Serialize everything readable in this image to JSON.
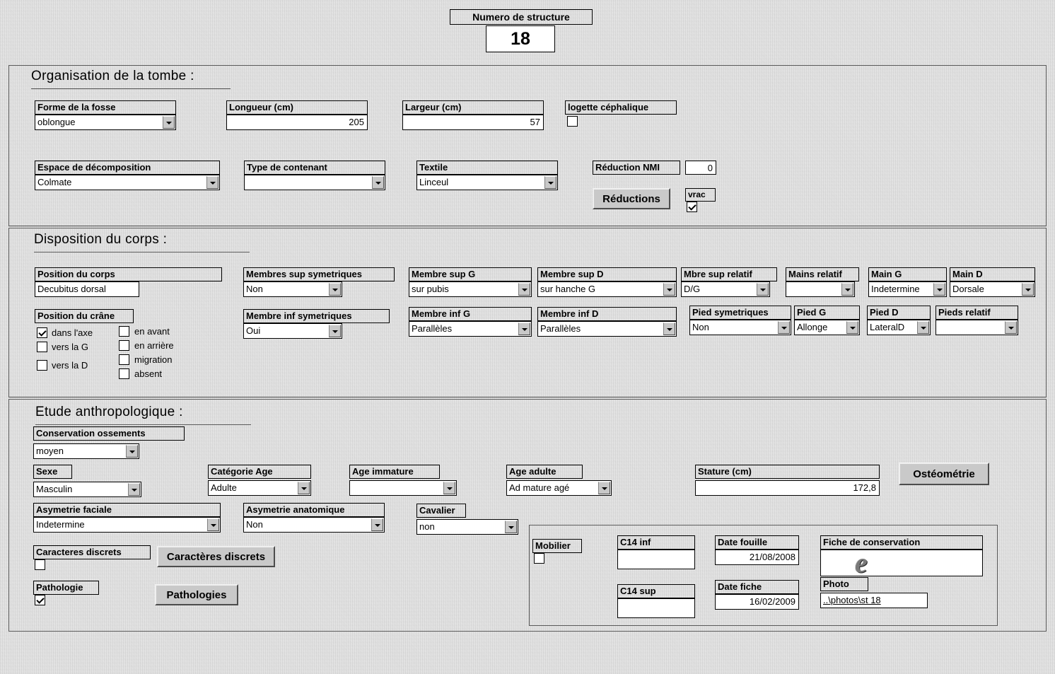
{
  "header": {
    "structure_label": "Numero de structure",
    "structure_value": "18"
  },
  "sections": {
    "tombe": {
      "title": "Organisation de la tombe :",
      "fields": {
        "forme_fosse": {
          "label": "Forme de la fosse",
          "value": "oblongue"
        },
        "longueur": {
          "label": "Longueur (cm)",
          "value": "205"
        },
        "largeur": {
          "label": "Largeur (cm)",
          "value": "57"
        },
        "logette": {
          "label": "logette céphalique",
          "checked": false
        },
        "espace_decomposition": {
          "label": "Espace de décomposition",
          "value": "Colmate"
        },
        "type_contenant": {
          "label": "Type de contenant",
          "value": ""
        },
        "textile": {
          "label": "Textile",
          "value": "Linceul"
        },
        "reduction_nmi": {
          "label": "Réduction NMI",
          "value": "0"
        },
        "reductions_button": "Réductions",
        "vrac": {
          "label": "vrac",
          "checked": true
        }
      }
    },
    "corps": {
      "title": "Disposition du corps :",
      "fields": {
        "position_corps": {
          "label": "Position du corps",
          "value": "Decubitus dorsal"
        },
        "membres_sup_sym": {
          "label": "Membres sup symetriques",
          "value": "Non"
        },
        "membre_sup_g": {
          "label": "Membre sup G",
          "value": "sur pubis"
        },
        "membre_sup_d": {
          "label": "Membre sup D",
          "value": "sur hanche G"
        },
        "mbre_sup_relatif": {
          "label": "Mbre sup relatif",
          "value": "D/G"
        },
        "mains_relatif": {
          "label": "Mains relatif",
          "value": ""
        },
        "main_g": {
          "label": "Main G",
          "value": "Indetermine"
        },
        "main_d": {
          "label": "Main D",
          "value": "Dorsale"
        },
        "position_crane": {
          "label": "Position du crâne"
        },
        "membre_inf_sym": {
          "label": "Membre inf symetriques",
          "value": "Oui"
        },
        "membre_inf_g": {
          "label": "Membre inf G",
          "value": "Parallèles"
        },
        "membre_inf_d": {
          "label": "Membre inf D",
          "value": "Parallèles"
        },
        "pied_sym": {
          "label": "Pied symetriques",
          "value": "Non"
        },
        "pied_g": {
          "label": "Pied G",
          "value": "Allonge"
        },
        "pied_d": {
          "label": "Pied D",
          "value": "LateralD"
        },
        "pieds_relatif": {
          "label": "Pieds relatif",
          "value": ""
        }
      },
      "crane_options_col1": [
        {
          "label": "dans l'axe",
          "checked": true
        },
        {
          "label": "vers la G",
          "checked": false
        },
        {
          "label": "vers la D",
          "checked": false
        }
      ],
      "crane_options_col2": [
        {
          "label": "en avant",
          "checked": false
        },
        {
          "label": "en arrière",
          "checked": false
        },
        {
          "label": "migration",
          "checked": false
        },
        {
          "label": "absent",
          "checked": false
        }
      ]
    },
    "anthropologie": {
      "title": "Etude anthropologique :",
      "fields": {
        "conservation_ossements": {
          "label": "Conservation ossements",
          "value": "moyen"
        },
        "sexe": {
          "label": "Sexe",
          "value": "Masculin"
        },
        "categorie_age": {
          "label": "Catégorie Age",
          "value": "Adulte"
        },
        "age_immature": {
          "label": "Age immature",
          "value": ""
        },
        "age_adulte": {
          "label": "Age adulte",
          "value": "Ad mature agé"
        },
        "stature": {
          "label": "Stature (cm)",
          "value": "172,8"
        },
        "osteometrie_button": "Ostéométrie",
        "asymetrie_faciale": {
          "label": "Asymetrie faciale",
          "value": "Indetermine"
        },
        "asymetrie_anatomique": {
          "label": "Asymetrie anatomique",
          "value": "Non"
        },
        "cavalier": {
          "label": "Cavalier",
          "value": "non"
        },
        "caracteres_discrets": {
          "label": "Caracteres discrets",
          "checked": false
        },
        "caracteres_discrets_button": "Caractères discrets",
        "pathologie": {
          "label": "Pathologie",
          "checked": true
        },
        "pathologies_button": "Pathologies",
        "mobilier": {
          "label": "Mobilier",
          "checked": false
        },
        "c14_inf": {
          "label": "C14 inf",
          "value": ""
        },
        "c14_sup": {
          "label": "C14 sup",
          "value": ""
        },
        "date_fouille": {
          "label": "Date fouille",
          "value": "21/08/2008"
        },
        "date_fiche": {
          "label": "Date fiche",
          "value": "16/02/2009"
        },
        "fiche_conservation": {
          "label": "Fiche de conservation",
          "icon": "internet-explorer-icon"
        },
        "photo": {
          "label": "Photo",
          "value": "..\\photos\\st 18"
        }
      }
    }
  }
}
